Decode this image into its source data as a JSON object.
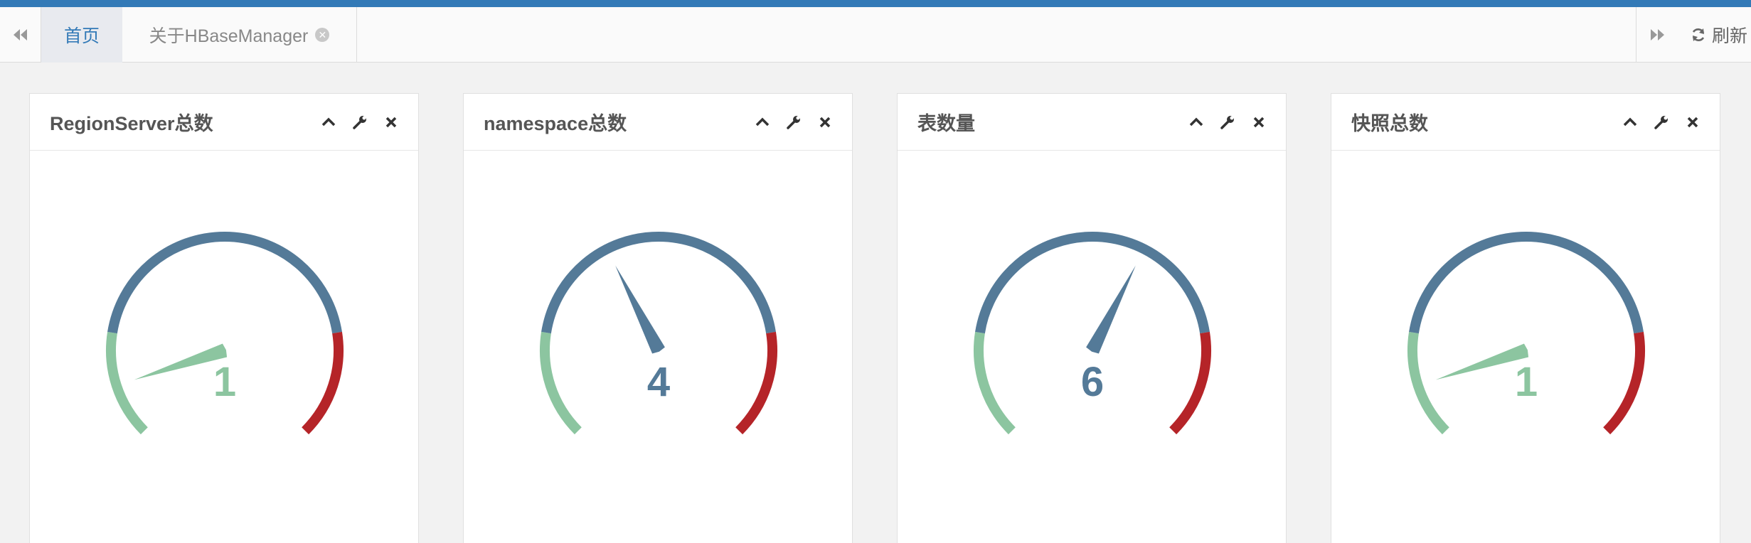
{
  "tabs": {
    "home_label": "首页",
    "about_label": "关于HBaseManager",
    "refresh_label": "刷新"
  },
  "icons": {
    "nav_left": "double-chevron-left-icon",
    "nav_right": "double-chevron-right-icon",
    "close": "close-circle-icon",
    "refresh": "refresh-icon",
    "collapse": "chevron-up-icon",
    "settings": "wrench-icon",
    "remove": "close-icon"
  },
  "colors": {
    "accent": "#337ab7",
    "gauge_green": "#8cc5a0",
    "gauge_blue": "#547a98",
    "gauge_red": "#b52428"
  },
  "panels": [
    {
      "title": "RegionServer总数",
      "value": 1
    },
    {
      "title": "namespace总数",
      "value": 4
    },
    {
      "title": "表数量",
      "value": 6
    },
    {
      "title": "快照总数",
      "value": 1
    }
  ],
  "chart_data": [
    {
      "type": "gauge",
      "title": "RegionServer总数",
      "values": [
        1
      ],
      "ylim": [
        0,
        10
      ],
      "bands": [
        {
          "from": 0,
          "to": 2,
          "color": "#8cc5a0"
        },
        {
          "from": 2,
          "to": 8,
          "color": "#547a98"
        },
        {
          "from": 8,
          "to": 10,
          "color": "#b52428"
        }
      ]
    },
    {
      "type": "gauge",
      "title": "namespace总数",
      "values": [
        4
      ],
      "ylim": [
        0,
        10
      ],
      "bands": [
        {
          "from": 0,
          "to": 2,
          "color": "#8cc5a0"
        },
        {
          "from": 2,
          "to": 8,
          "color": "#547a98"
        },
        {
          "from": 8,
          "to": 10,
          "color": "#b52428"
        }
      ]
    },
    {
      "type": "gauge",
      "title": "表数量",
      "values": [
        6
      ],
      "ylim": [
        0,
        10
      ],
      "bands": [
        {
          "from": 0,
          "to": 2,
          "color": "#8cc5a0"
        },
        {
          "from": 2,
          "to": 8,
          "color": "#547a98"
        },
        {
          "from": 8,
          "to": 10,
          "color": "#b52428"
        }
      ]
    },
    {
      "type": "gauge",
      "title": "快照总数",
      "values": [
        1
      ],
      "ylim": [
        0,
        10
      ],
      "bands": [
        {
          "from": 0,
          "to": 2,
          "color": "#8cc5a0"
        },
        {
          "from": 2,
          "to": 8,
          "color": "#547a98"
        },
        {
          "from": 8,
          "to": 10,
          "color": "#b52428"
        }
      ]
    }
  ]
}
